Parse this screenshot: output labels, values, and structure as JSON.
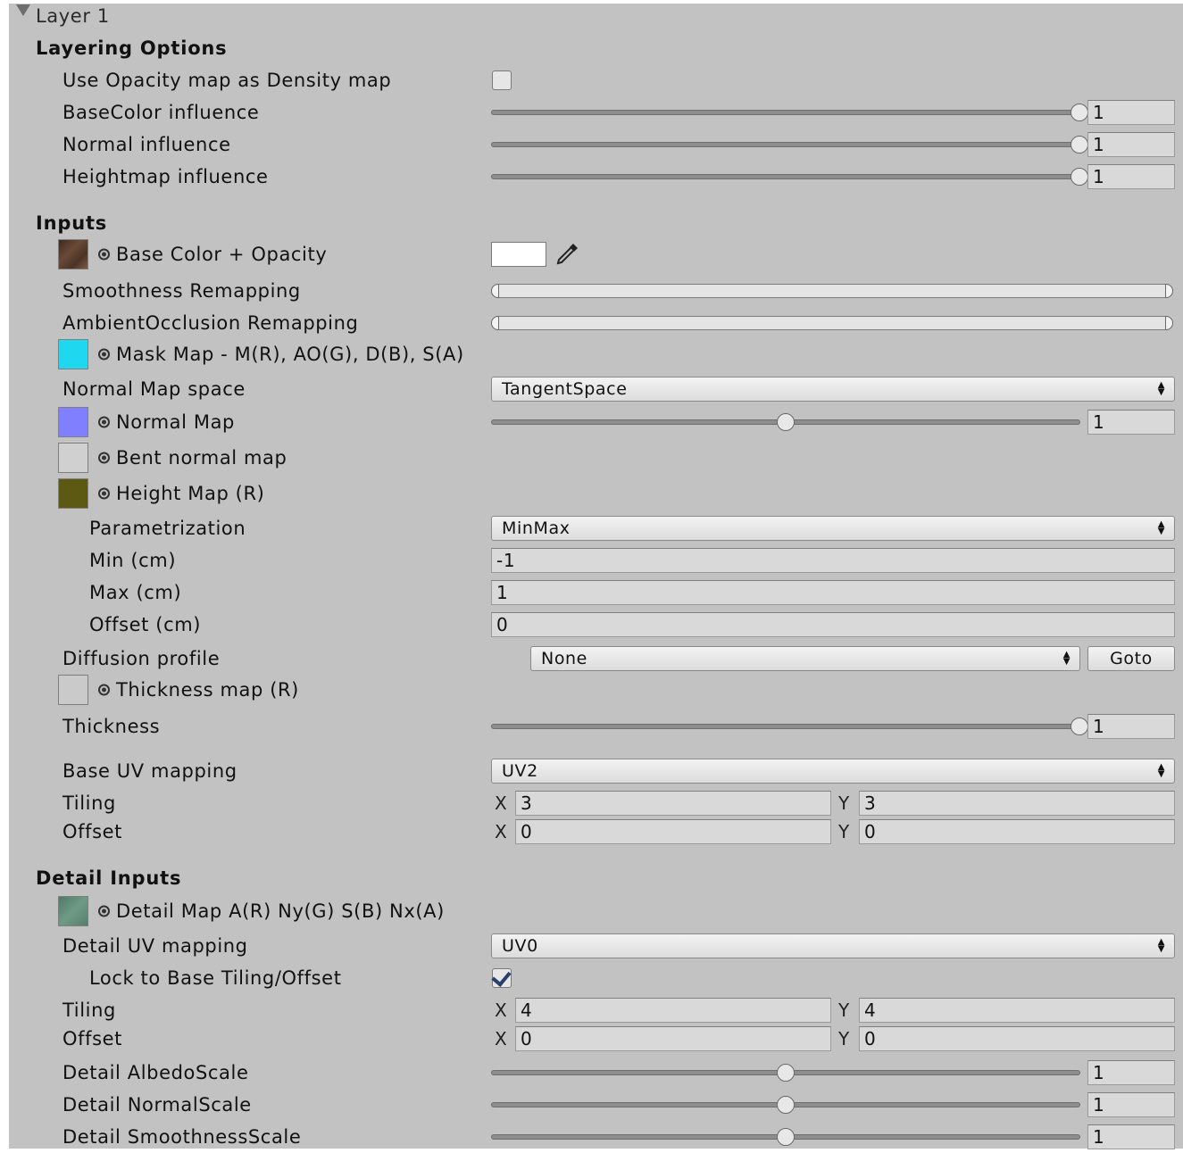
{
  "layer": {
    "title": "Layer 1"
  },
  "layering_options": {
    "header": "Layering Options",
    "opacity_density_label": "Use Opacity map as Density map",
    "opacity_density_checked": false,
    "basecolor_label": "BaseColor influence",
    "basecolor_value": "1",
    "basecolor_level": 1.0,
    "normal_label": "Normal influence",
    "normal_value": "1",
    "normal_level": 1.0,
    "heightmap_label": "Heightmap influence",
    "heightmap_value": "1",
    "heightmap_level": 1.0
  },
  "inputs": {
    "header": "Inputs",
    "base_color_label": "Base Color + Opacity",
    "base_color_swatch": "#ffffff",
    "smoothness_label": "Smoothness Remapping",
    "ao_label": "AmbientOcclusion Remapping",
    "mask_map_label": "Mask Map - M(R), AO(G), D(B), S(A)",
    "normal_space_label": "Normal Map space",
    "normal_space_value": "TangentSpace",
    "normal_map_label": "Normal Map",
    "normal_map_value": "1",
    "normal_map_level": 0.5,
    "bent_normal_label": "Bent normal map",
    "height_map_label": "Height Map (R)",
    "parametrization_label": "Parametrization",
    "parametrization_value": "MinMax",
    "min_label": "Min (cm)",
    "min_value": "-1",
    "max_label": "Max (cm)",
    "max_value": "1",
    "offset_cm_label": "Offset (cm)",
    "offset_cm_value": "0",
    "diffusion_label": "Diffusion profile",
    "diffusion_value": "None",
    "goto_label": "Goto",
    "thickness_map_label": "Thickness map (R)",
    "thickness_label": "Thickness",
    "thickness_value": "1",
    "thickness_level": 1.0,
    "base_uv_label": "Base UV mapping",
    "base_uv_value": "UV2",
    "tiling_label": "Tiling",
    "tiling_x": "3",
    "tiling_y": "3",
    "offset_label": "Offset",
    "offset_x": "0",
    "offset_y": "0",
    "axis_x": "X",
    "axis_y": "Y"
  },
  "detail_inputs": {
    "header": "Detail Inputs",
    "detail_map_label": "Detail Map A(R) Ny(G) S(B) Nx(A)",
    "detail_uv_label": "Detail UV mapping",
    "detail_uv_value": "UV0",
    "lock_label": "Lock to Base Tiling/Offset",
    "lock_checked": true,
    "tiling_label": "Tiling",
    "tiling_x": "4",
    "tiling_y": "4",
    "offset_label": "Offset",
    "offset_x": "0",
    "offset_y": "0",
    "albedo_label": "Detail AlbedoScale",
    "albedo_value": "1",
    "albedo_level": 0.5,
    "normal_label": "Detail NormalScale",
    "normal_value": "1",
    "normal_level": 0.5,
    "smoothness_label": "Detail SmoothnessScale",
    "smoothness_value": "1",
    "smoothness_level": 0.5
  },
  "colors": {
    "panel_bg": "#c2c2c2",
    "base_color_thumb": "#5a4030",
    "mask_map_thumb": "#1fd8f0",
    "normal_map_thumb": "#7f7fff",
    "bent_normal_thumb": "#d0d0d0",
    "height_map_thumb": "#5c5a12",
    "thickness_thumb": "#cacaca",
    "detail_map_thumb": "#5f8a78",
    "checkmark": "#2b3f6e"
  }
}
